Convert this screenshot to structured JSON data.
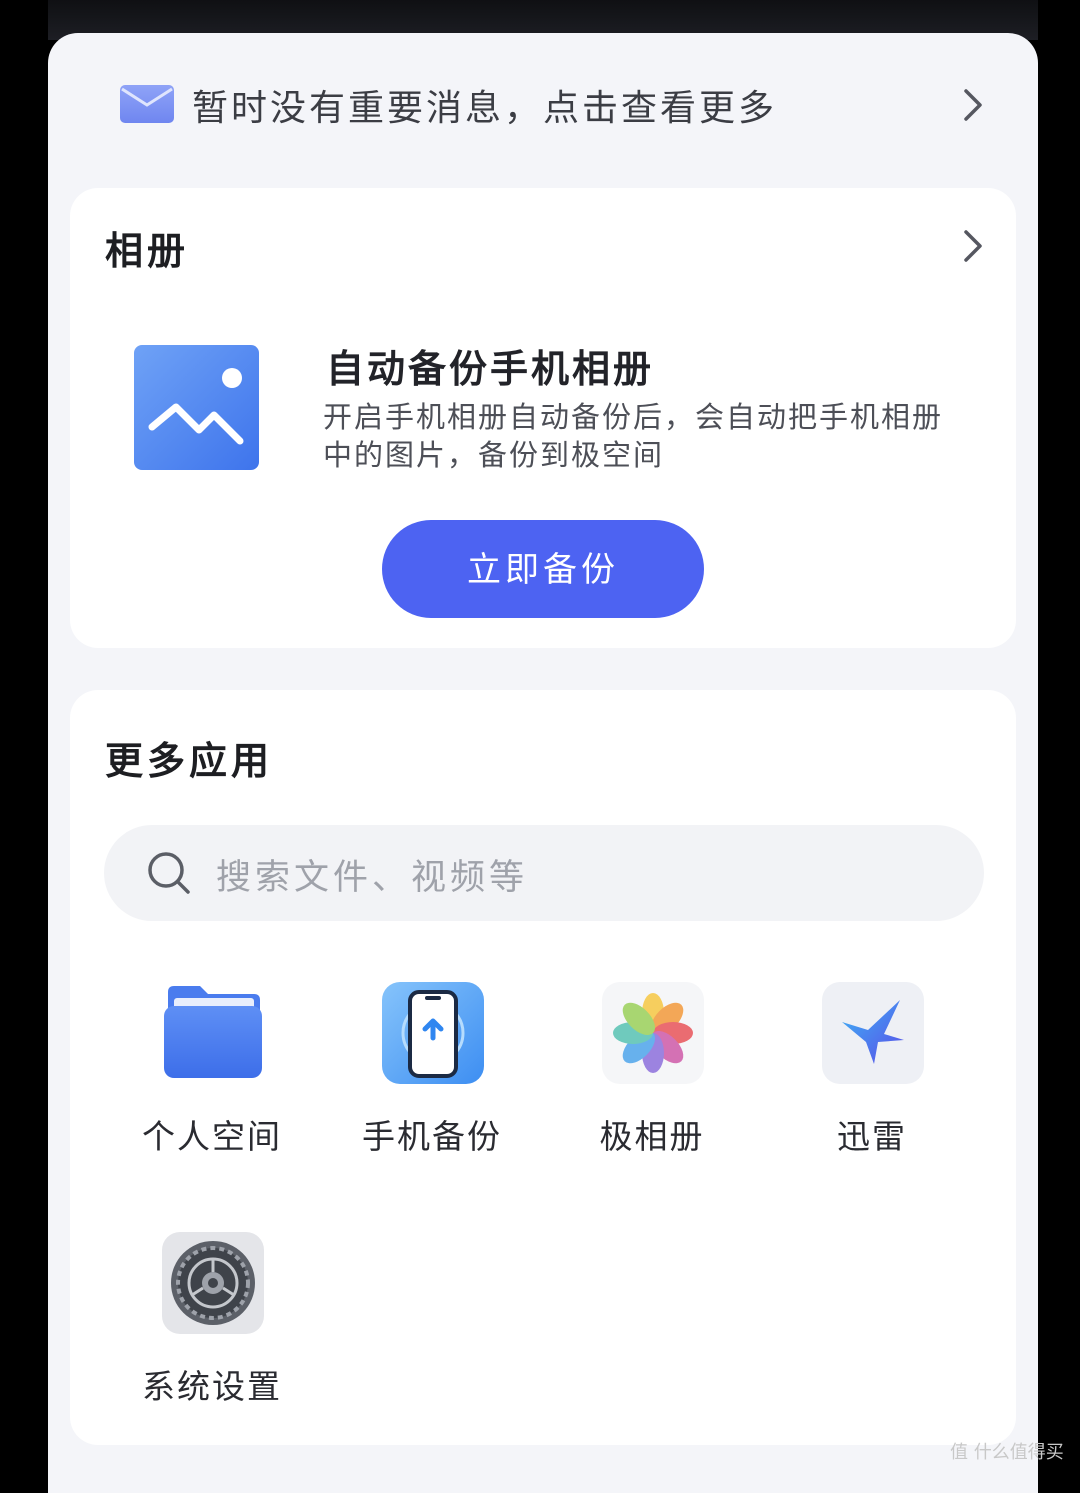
{
  "message_bar": {
    "text": "暂时没有重要消息，点击查看更多",
    "icon": "mail-icon"
  },
  "album_card": {
    "title": "相册",
    "backup_title": "自动备份手机相册",
    "backup_desc": "开启手机相册自动备份后，会自动把手机相册中的图片，备份到极空间",
    "backup_button": "立即备份",
    "icon": "image-icon"
  },
  "apps_card": {
    "title": "更多应用",
    "search_placeholder": "搜索文件、视频等",
    "apps": [
      {
        "label": "个人空间",
        "icon": "folder-icon"
      },
      {
        "label": "手机备份",
        "icon": "phone-backup-icon"
      },
      {
        "label": "极相册",
        "icon": "photos-icon"
      },
      {
        "label": "迅雷",
        "icon": "xunlei-icon"
      },
      {
        "label": "系统设置",
        "icon": "settings-gear-icon"
      }
    ]
  },
  "watermark": "值 什么值得买",
  "colors": {
    "accent": "#4d63f2",
    "background": "#f4f5f9",
    "card": "#ffffff"
  }
}
